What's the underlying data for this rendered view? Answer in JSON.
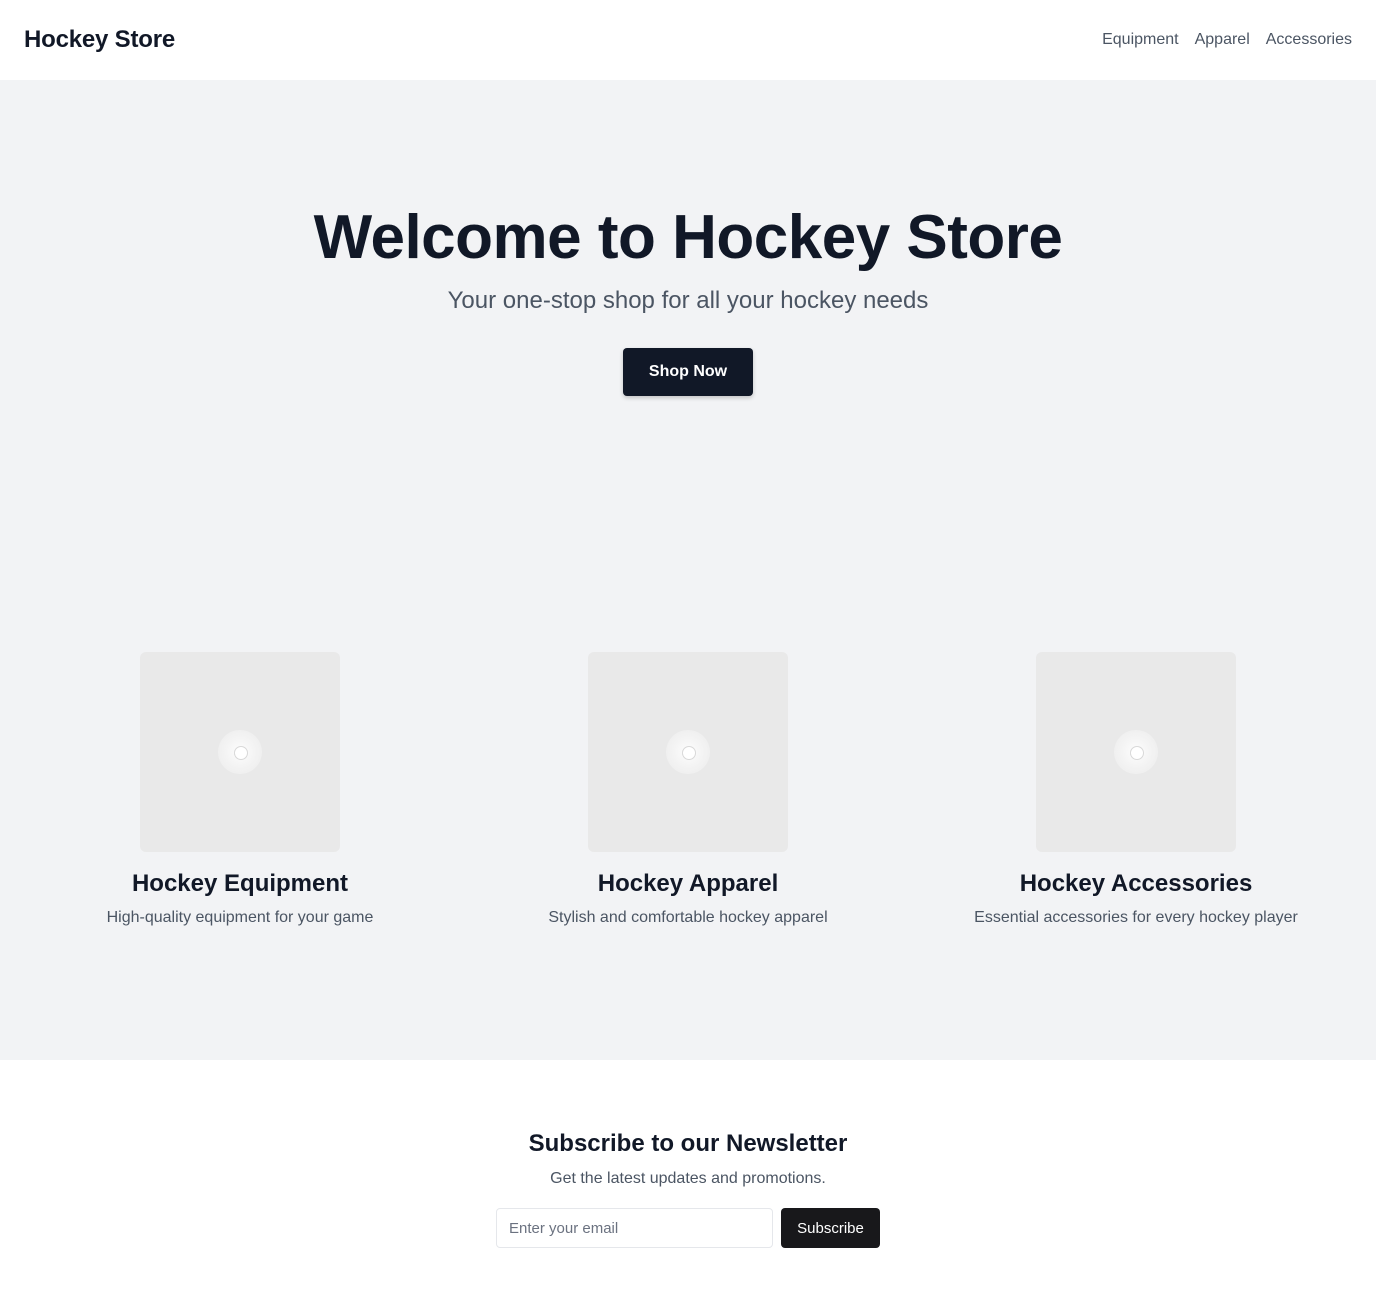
{
  "header": {
    "logo": "Hockey Store",
    "nav": [
      {
        "label": "Equipment"
      },
      {
        "label": "Apparel"
      },
      {
        "label": "Accessories"
      }
    ]
  },
  "hero": {
    "title": "Welcome to Hockey Store",
    "subtitle": "Your one-stop shop for all your hockey needs",
    "cta_label": "Shop Now"
  },
  "categories": [
    {
      "title": "Hockey Equipment",
      "description": "High-quality equipment for your game",
      "icon": "image-placeholder-icon"
    },
    {
      "title": "Hockey Apparel",
      "description": "Stylish and comfortable hockey apparel",
      "icon": "image-placeholder-icon"
    },
    {
      "title": "Hockey Accessories",
      "description": "Essential accessories for every hockey player",
      "icon": "image-placeholder-icon"
    }
  ],
  "newsletter": {
    "title": "Subscribe to our Newsletter",
    "text": "Get the latest updates and promotions.",
    "email_placeholder": "Enter your email",
    "email_value": "",
    "subscribe_label": "Subscribe"
  },
  "colors": {
    "primary": "#111827",
    "muted_text": "#4b5563",
    "section_bg": "#f2f3f5",
    "subscribe_button": "#18181b"
  }
}
